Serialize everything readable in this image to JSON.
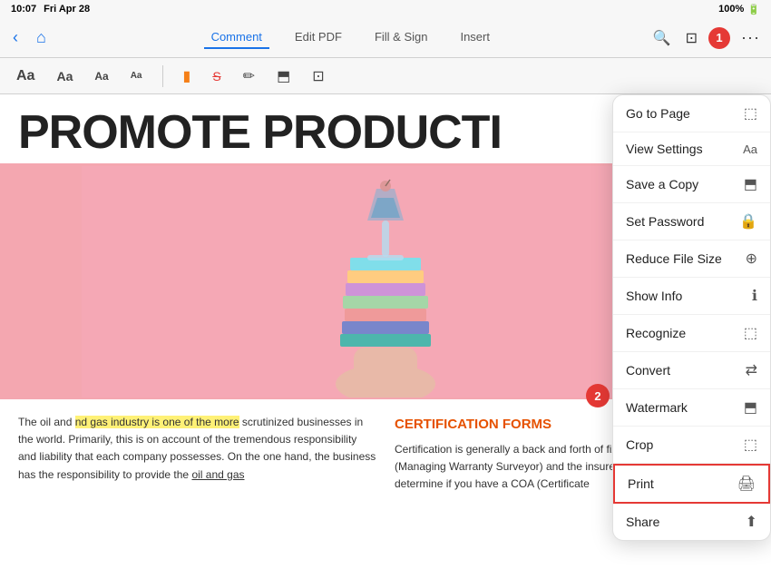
{
  "statusBar": {
    "time": "10:07",
    "day": "Fri Apr 28",
    "battery": "100%",
    "signal": "●●●●"
  },
  "toolbar": {
    "tabs": [
      {
        "id": "comment",
        "label": "Comment",
        "active": true
      },
      {
        "id": "editpdf",
        "label": "Edit PDF",
        "active": false
      },
      {
        "id": "fillsign",
        "label": "Fill & Sign",
        "active": false
      },
      {
        "id": "insert",
        "label": "Insert",
        "active": false
      }
    ],
    "backLabel": "‹",
    "homeLabel": "⌂",
    "searchLabel": "🔍",
    "shareLabel": "⊡",
    "moreLabel": "···"
  },
  "annotationBar": {
    "textItems": [
      {
        "label": "Aa",
        "style": "large"
      },
      {
        "label": "Aa",
        "style": "medium"
      },
      {
        "label": "Aa",
        "style": "small"
      },
      {
        "label": "Aa",
        "style": "xsmall"
      }
    ],
    "tools": [
      {
        "name": "highlight",
        "icon": "▮"
      },
      {
        "name": "strikethrough",
        "icon": "S̶"
      },
      {
        "name": "pencil",
        "icon": "✏"
      },
      {
        "name": "stamp",
        "icon": "⬒"
      },
      {
        "name": "more",
        "icon": "⊡"
      }
    ]
  },
  "pdf": {
    "title": "PROMOTE PRODUCTI",
    "highlightedText": "nd gas industry is one of the more",
    "leftColumnText": "The oil and gas industry is one of the more scrutinized businesses in the world. Primarily, this is on account of the tremendous responsibility and liability that each company possesses. On the one hand, the business has the responsibility to provide the oil and gas",
    "rightColumnTitle": "CERTIFICATION FORMS",
    "rightColumnText": "Certification is generally a back and forth of fixes between the MWS (Managing Warranty Surveyor) and the insurer. Since the MWS will determine if you have a COA (Certificate"
  },
  "menu": {
    "items": [
      {
        "id": "goto",
        "label": "Go to Page",
        "icon": "⬚"
      },
      {
        "id": "viewsettings",
        "label": "View Settings",
        "icon": "Aa"
      },
      {
        "id": "savecopy",
        "label": "Save a Copy",
        "icon": "⬒"
      },
      {
        "id": "setpassword",
        "label": "Set Password",
        "icon": "🔒"
      },
      {
        "id": "reducefilesize",
        "label": "Reduce File Size",
        "icon": "⊕"
      },
      {
        "id": "showinfo",
        "label": "Show Info",
        "icon": "ℹ"
      },
      {
        "id": "recognize",
        "label": "Recognize",
        "icon": "⬚"
      },
      {
        "id": "convert",
        "label": "Convert",
        "icon": "⇄"
      },
      {
        "id": "watermark",
        "label": "Watermark",
        "icon": "⬒"
      },
      {
        "id": "crop",
        "label": "Crop",
        "icon": "⬚"
      },
      {
        "id": "print",
        "label": "Print",
        "icon": "🖨",
        "highlighted": true
      },
      {
        "id": "share",
        "label": "Share",
        "icon": "⬆"
      }
    ]
  },
  "badges": {
    "badge1": "1",
    "badge2": "2"
  },
  "colors": {
    "accent": "#e53935",
    "activeTab": "#1a73e8",
    "certTitle": "#e65100",
    "highlight": "#fff176",
    "pinkBg": "#f4a7b0"
  }
}
